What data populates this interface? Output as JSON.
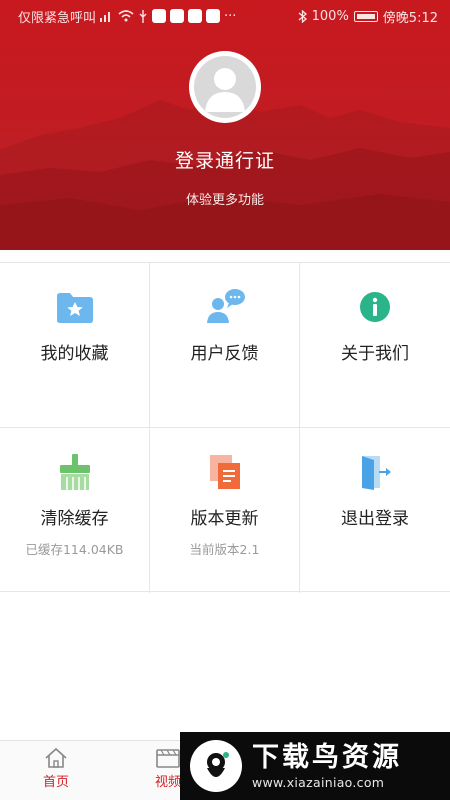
{
  "status_bar": {
    "carrier": "仅限紧急呼叫",
    "battery_percent": "100%",
    "time": "傍晚5:12",
    "icons": [
      "signal-icon",
      "wifi-icon",
      "usb-icon",
      "app-notification-icon",
      "bluetooth-icon",
      "battery-icon"
    ]
  },
  "profile": {
    "login_title": "登录通行证",
    "login_subtitle": "体验更多功能"
  },
  "grid": [
    {
      "label": "我的收藏",
      "sub": "",
      "icon": "favorites-folder-icon"
    },
    {
      "label": "用户反馈",
      "sub": "",
      "icon": "feedback-user-icon"
    },
    {
      "label": "关于我们",
      "sub": "",
      "icon": "info-icon"
    },
    {
      "label": "清除缓存",
      "sub": "已缓存114.04KB",
      "icon": "broom-icon"
    },
    {
      "label": "版本更新",
      "sub": "当前版本2.1",
      "icon": "copy-document-icon"
    },
    {
      "label": "退出登录",
      "sub": "",
      "icon": "exit-door-icon"
    }
  ],
  "bottom_nav": [
    {
      "label": "首页",
      "icon": "home-icon"
    },
    {
      "label": "视频",
      "icon": "video-icon"
    }
  ],
  "watermark": {
    "title": "下载鸟资源",
    "url": "www.xiazainiao.com"
  },
  "colors": {
    "header_red": "#c8191f",
    "nav_active": "#d32026",
    "icon_blue": "#6cb8ee",
    "icon_teal": "#2bb38a",
    "icon_green": "#6cc36b",
    "icon_orange": "#f06a3a"
  }
}
